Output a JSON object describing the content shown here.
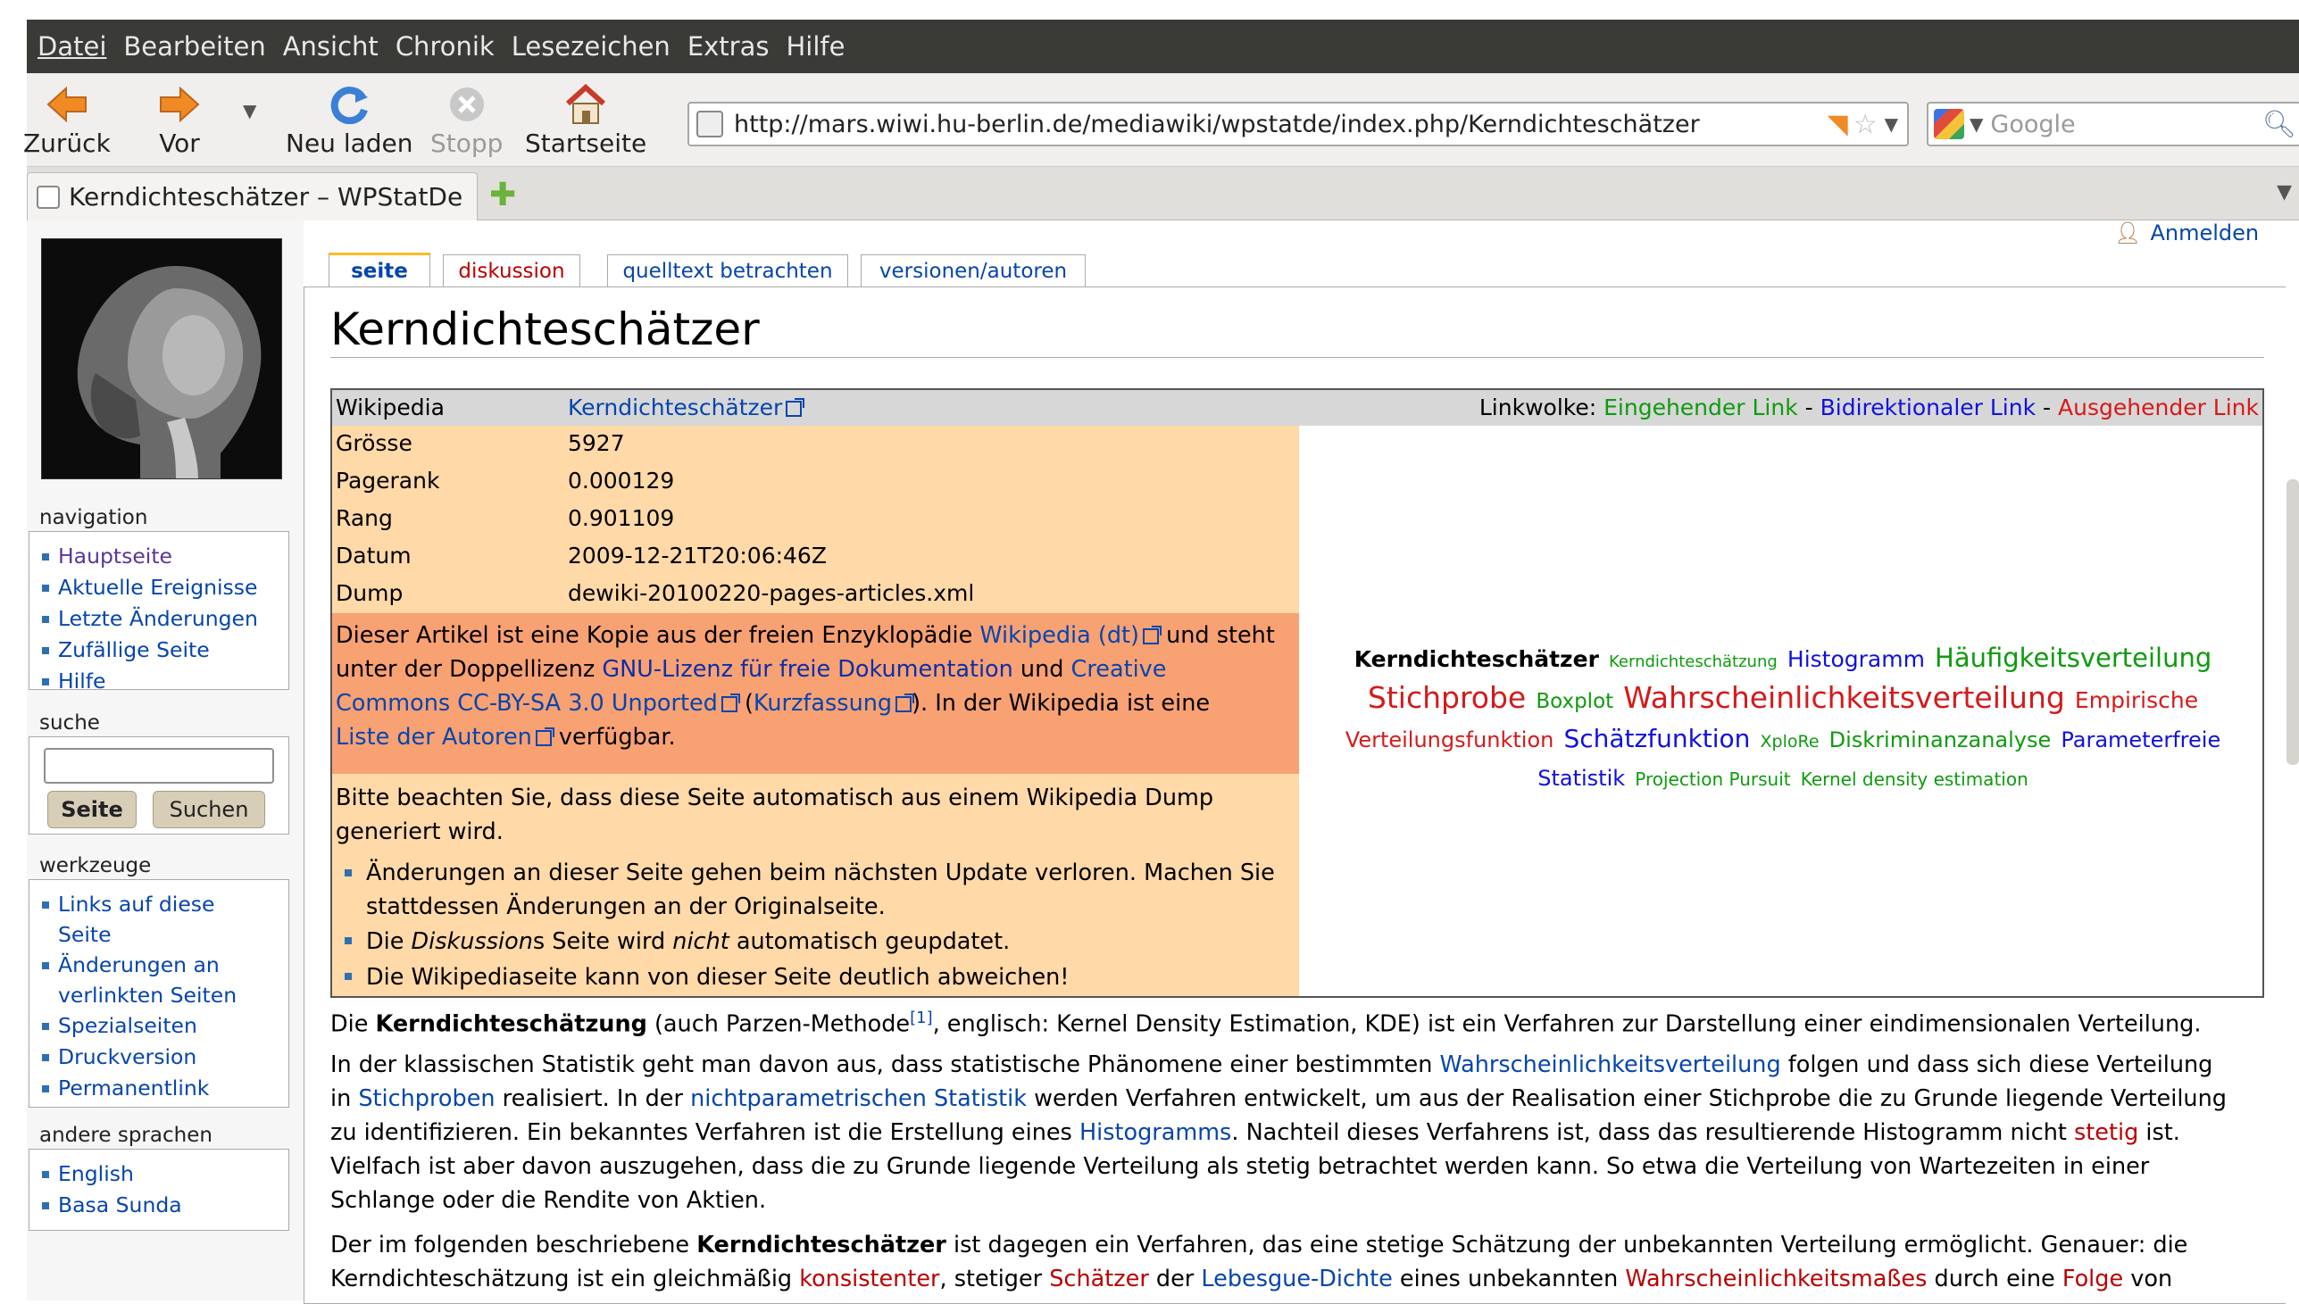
{
  "menu": [
    "Datei",
    "Bearbeiten",
    "Ansicht",
    "Chronik",
    "Lesezeichen",
    "Extras",
    "Hilfe"
  ],
  "toolbar": {
    "back": "Zurück",
    "forward": "Vor",
    "reload": "Neu laden",
    "stop": "Stopp",
    "home": "Startseite"
  },
  "address": {
    "url": "http://mars.wiwi.hu-berlin.de/mediawiki/wpstatde/index.php/Kerndichteschätzer"
  },
  "search": {
    "placeholder": "Google"
  },
  "tab": {
    "title": "Kerndichteschätzer – WPStatDe"
  },
  "sidebar": {
    "nav_heading": "navigation",
    "nav_items": [
      "Hauptseite",
      "Aktuelle Ereignisse",
      "Letzte Änderungen",
      "Zufällige Seite",
      "Hilfe"
    ],
    "search_heading": "suche",
    "search_btn_go": "Seite",
    "search_btn_search": "Suchen",
    "tools_heading": "werkzeuge",
    "tools_items": [
      "Links auf diese Seite",
      "Änderungen an verlinkten Seiten",
      "Spezialseiten",
      "Druckversion",
      "Permanentlink"
    ],
    "lang_heading": "andere sprachen",
    "lang_items": [
      "English",
      "Basa Sunda"
    ]
  },
  "user": {
    "login": "Anmelden"
  },
  "page_tabs": [
    "seite",
    "diskussion",
    "quelltext betrachten",
    "versionen/autoren"
  ],
  "page": {
    "title": "Kerndichteschätzer"
  },
  "info": {
    "wiki_label": "Wikipedia",
    "wiki_link": "Kerndichteschätzer",
    "linkwolke_label": "Linkwolke:",
    "linkwolke_in": "Eingehender Link",
    "linkwolke_bi": "Bidirektionaler Link",
    "linkwolke_out": "Ausgehender Link",
    "sep": "-",
    "rows": [
      {
        "k": "Grösse",
        "v": "5927"
      },
      {
        "k": "Pagerank",
        "v": "0.000129"
      },
      {
        "k": "Rang",
        "v": "0.901109"
      },
      {
        "k": "Datum",
        "v": "2009-12-21T20:06:46Z"
      },
      {
        "k": "Dump",
        "v": "dewiki-20100220-pages-articles.xml"
      }
    ],
    "license": {
      "t1": "Dieser Artikel ist eine Kopie aus der freien Enzyklopädie ",
      "l1": "Wikipedia (dt)",
      "t2": " und steht",
      "t3": "unter der Doppellizenz ",
      "l2": "GNU-Lizenz für freie Dokumentation",
      "t4": " und ",
      "l3": "Creative",
      "l3b": "Commons CC-BY-SA 3.0 Unported",
      "t5": " (",
      "l4": "Kurzfassung",
      "t6": "). In der Wikipedia ist eine",
      "l5": "Liste der Autoren",
      "t7": " verfügbar."
    },
    "notice": "Bitte beachten Sie, dass diese Seite automatisch aus einem Wikipedia Dump",
    "notice2": "generiert wird.",
    "bullets": {
      "b1a": "Änderungen an dieser Seite gehen beim nächsten Update verloren. Machen Sie",
      "b1b": "stattdessen Änderungen an der Originalseite.",
      "b2a": "Die ",
      "b2b": "Diskussion",
      "b2c": "s Seite wird ",
      "b2d": "nicht",
      "b2e": " automatisch geupdatet.",
      "b3": "Die Wikipediaseite kann von dieser Seite deutlich abweichen!"
    }
  },
  "cloud": [
    {
      "t": "Kerndichteschätzer",
      "c": "#000000",
      "s": 25,
      "b": true
    },
    {
      "t": "Kerndichteschätzung",
      "c": "#0e9b0e",
      "s": 18
    },
    {
      "t": "Histogramm",
      "c": "#1111dd",
      "s": 25
    },
    {
      "t": "Häufigkeitsverteilung",
      "c": "#0e9b0e",
      "s": 29
    },
    {
      "t": "Stichprobe",
      "c": "#d51a1a",
      "s": 33
    },
    {
      "t": "Boxplot",
      "c": "#0e9b0e",
      "s": 23
    },
    {
      "t": "Wahrscheinlichkeitsverteilung",
      "c": "#d51a1a",
      "s": 33
    },
    {
      "t": "Empirische",
      "c": "#d51a1a",
      "s": 25
    },
    {
      "t": "Verteilungsfunktion",
      "c": "#d51a1a",
      "s": 24
    },
    {
      "t": "Schätzfunktion",
      "c": "#1111dd",
      "s": 28
    },
    {
      "t": "XploRe",
      "c": "#0e9b0e",
      "s": 19
    },
    {
      "t": "Diskriminanzanalyse",
      "c": "#0e9b0e",
      "s": 24
    },
    {
      "t": "Parameterfreie",
      "c": "#1111dd",
      "s": 24
    },
    {
      "t": "Statistik",
      "c": "#1111dd",
      "s": 24
    },
    {
      "t": "Projection Pursuit",
      "c": "#0e9b0e",
      "s": 20
    },
    {
      "t": "Kernel density estimation",
      "c": "#0e9b0e",
      "s": 20
    }
  ],
  "article": {
    "p1": {
      "a": "Die ",
      "b": "Kerndichteschätzung",
      "c": " (auch Parzen-Methode",
      "sup": "[1]",
      "d": ", englisch: Kernel Density Estimation, KDE) ist ein Verfahren zur Darstellung einer eindimensionalen Verteilung."
    },
    "p2": {
      "a": "In der klassischen Statistik geht man davon aus, dass statistische Phänomene einer bestimmten ",
      "l1": "Wahrscheinlichkeitsverteilung",
      "b": " folgen und dass sich diese Verteilung",
      "c": "in ",
      "l2": "Stichproben",
      "d": " realisiert. In der ",
      "l3": "nichtparametrischen Statistik",
      "e": " werden Verfahren entwickelt, um aus der Realisation einer Stichprobe die zu Grunde liegende Verteilung",
      "f": "zu identifizieren. Ein bekanntes Verfahren ist die Erstellung eines ",
      "l4": "Histogramms",
      "g": ". Nachteil dieses Verfahrens ist, dass das resultierende Histogramm nicht ",
      "l5": "stetig",
      "h": " ist.",
      "i": "Vielfach ist aber davon auszugehen, dass die zu Grunde liegende Verteilung als stetig betrachtet werden kann. So etwa die Verteilung von Wartezeiten in einer",
      "j": "Schlange oder die Rendite von Aktien."
    },
    "p3": {
      "a": "Der im folgenden beschriebene ",
      "b": "Kerndichteschätzer",
      "c": " ist dagegen ein Verfahren, das eine stetige Schätzung der unbekannten Verteilung ermöglicht. Genauer: die",
      "d": "Kerndichteschätzung ist ein gleichmäßig ",
      "l1": "konsistenter",
      "e": ", stetiger ",
      "l2": "Schätzer",
      "f": " der ",
      "l3": "Lebesgue-Dichte",
      "g": " eines unbekannten ",
      "l4": "Wahrscheinlichkeitsmaßes",
      "h": " durch eine ",
      "l5": "Folge",
      "i": " von"
    }
  }
}
